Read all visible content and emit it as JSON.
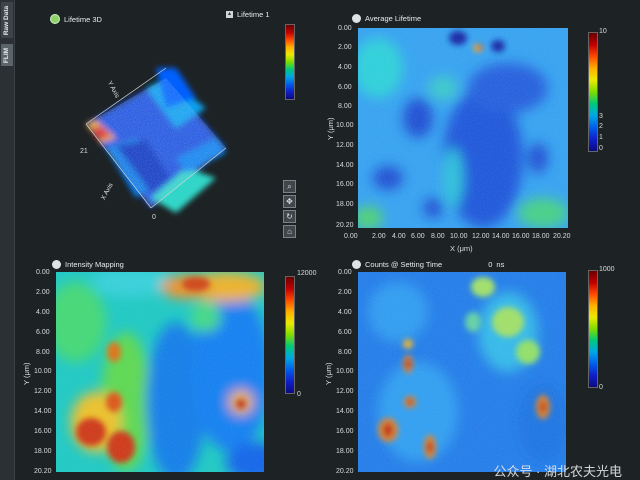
{
  "side_tabs": [
    "Raw Data",
    "FLIM"
  ],
  "panels": {
    "lifetime3d": {
      "title": "Lifetime 3D",
      "selector_label": "Lifetime 1",
      "x_axis_title": "X Axis",
      "y_axis_title": "Y Axis",
      "axis_ticks_visible": [
        "21",
        "0"
      ]
    },
    "average_lifetime": {
      "title": "Average Lifetime",
      "x_axis_title": "X (μm)",
      "y_axis_title": "Y (μm)",
      "y_ticks": [
        "0.00",
        "2.00",
        "4.00",
        "6.00",
        "8.00",
        "10.00",
        "12.00",
        "14.00",
        "16.00",
        "18.00",
        "20.20"
      ],
      "x_ticks": [
        "20.20",
        "0.00",
        "2.00",
        "4.00",
        "6.00",
        "8.00",
        "10.00",
        "12.00",
        "14.00",
        "16.00",
        "18.00",
        "20.20"
      ],
      "colorbar_ticks": [
        "10",
        "3",
        "2",
        "1",
        "0"
      ]
    },
    "intensity_mapping": {
      "title": "Intensity Mapping",
      "y_axis_title": "Y (μm)",
      "y_ticks": [
        "0.00",
        "2.00",
        "4.00",
        "6.00",
        "8.00",
        "10.00",
        "12.00",
        "14.00",
        "16.00",
        "18.00",
        "20.20"
      ],
      "colorbar_ticks": [
        "12000",
        "0"
      ]
    },
    "counts": {
      "title": "Counts @ Setting Time",
      "time_value": "0",
      "time_unit": "ns",
      "y_axis_title": "Y (μm)",
      "y_ticks": [
        "0.00",
        "2.00",
        "4.00",
        "6.00",
        "8.00",
        "10.00",
        "12.00",
        "14.00",
        "16.00",
        "18.00",
        "20.20"
      ],
      "colorbar_ticks": [
        "1000",
        "0"
      ]
    }
  },
  "tool_icons": [
    "zoom-icon",
    "pan-icon",
    "rotate-icon",
    "reset-icon"
  ],
  "watermark": "公众号 · 湖北农夫光电"
}
